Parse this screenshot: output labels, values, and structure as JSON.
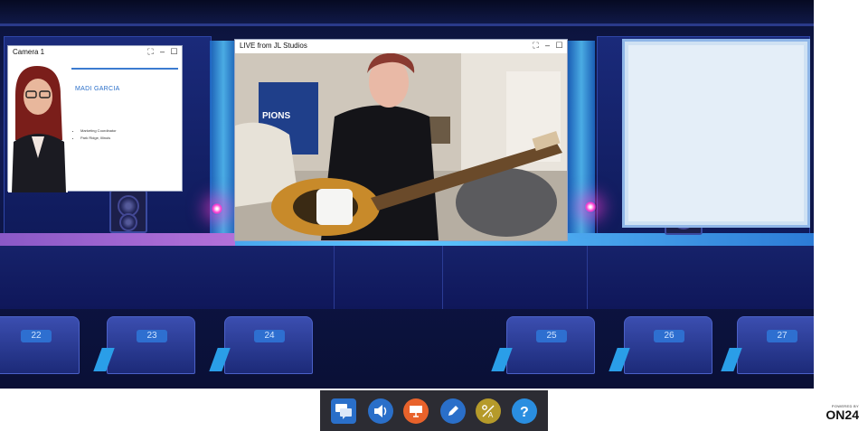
{
  "camera_window": {
    "title": "Camera 1",
    "speaker_name": "MADI GARCIA",
    "bullets": [
      "Marketing Coordinator",
      "Park Ridge, Illinois"
    ]
  },
  "live_window": {
    "title": "LIVE from JL Studios",
    "banner_text": "SERIES\nPIONS"
  },
  "seats": [
    "22",
    "23",
    "24",
    "25",
    "26",
    "27"
  ],
  "dock": {
    "buttons": [
      {
        "name": "q-and-a-icon",
        "color": "#2a6fc9"
      },
      {
        "name": "audio-icon",
        "color": "#2a6fc9"
      },
      {
        "name": "slides-icon",
        "color": "#e8622b"
      },
      {
        "name": "notes-icon",
        "color": "#2a6fc9"
      },
      {
        "name": "survey-icon",
        "color": "#b59a2a"
      },
      {
        "name": "help-icon",
        "color": "#2a8ee0"
      }
    ]
  },
  "branding": {
    "powered_by": "POWERED BY",
    "logo": "ON24"
  }
}
